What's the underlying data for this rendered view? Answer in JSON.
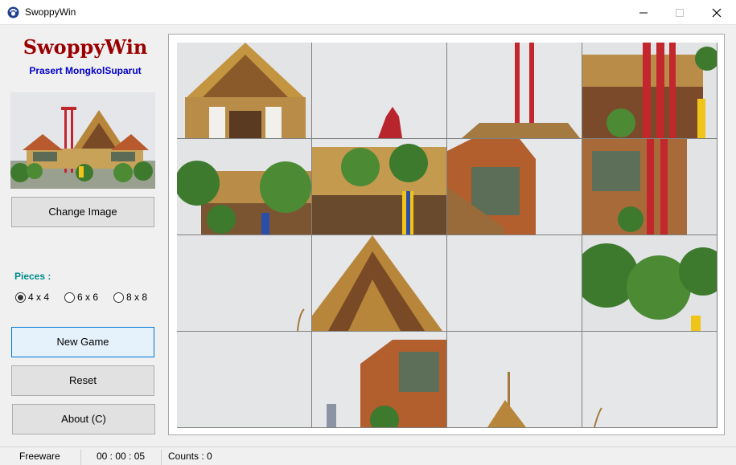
{
  "window": {
    "title": "SwoppyWin",
    "icon": "paw-icon"
  },
  "sidebar": {
    "app_name": "SwoppyWin",
    "author": "Prasert MongkolSuparut",
    "change_image_label": "Change Image",
    "pieces_label": "Pieces :",
    "piece_options": [
      {
        "label": "4 x 4",
        "checked": true
      },
      {
        "label": "6 x 6",
        "checked": false
      },
      {
        "label": "8 x 8",
        "checked": false
      }
    ],
    "new_game_label": "New Game",
    "reset_label": "Reset",
    "about_label": "About  (C)"
  },
  "board": {
    "grid": "4 x 4",
    "tile_count": 16
  },
  "status": {
    "license": "Freeware",
    "timer": "00 : 00 : 05",
    "counts": "Counts : 0"
  },
  "colors": {
    "app_name": "#9b0000",
    "author": "#0000cc",
    "pieces_label": "#008b8b",
    "sky": "#e6e7e9",
    "roof_red": "#b0242a",
    "gold": "#c79a3a",
    "tree_green": "#3d7a2e"
  }
}
